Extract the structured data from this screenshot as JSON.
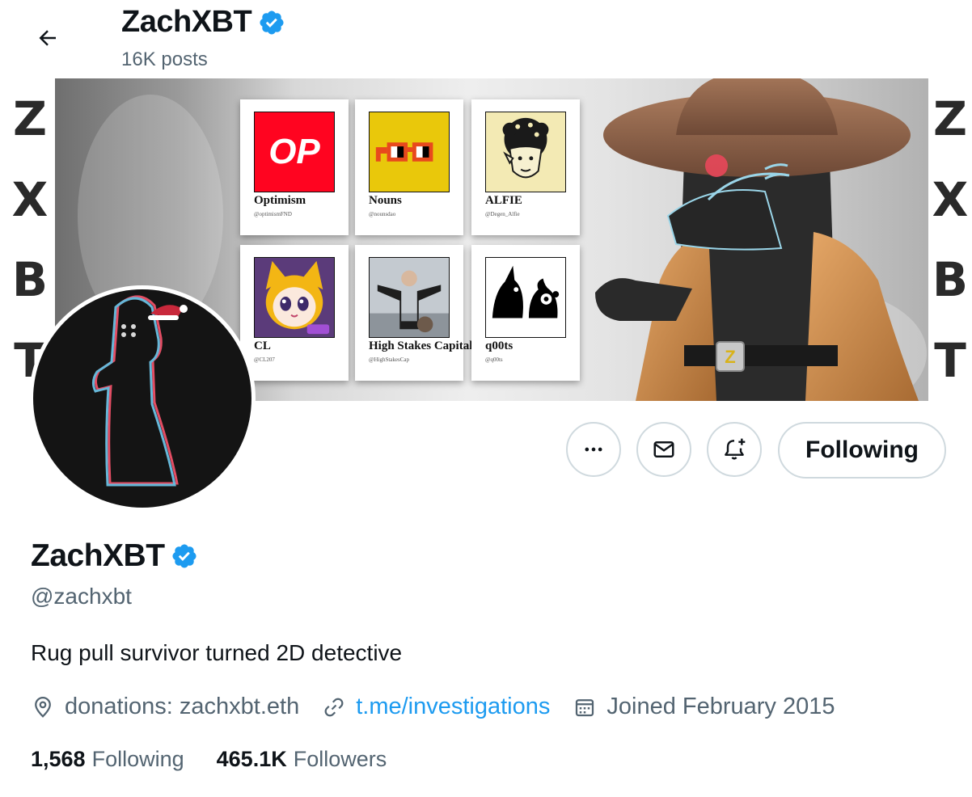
{
  "header": {
    "title": "ZachXBT",
    "posts": "16K posts"
  },
  "banner": {
    "edge_letters": [
      "Z",
      "X",
      "B",
      "T"
    ],
    "cards": [
      {
        "name": "Optimism",
        "handle": "@optimismFND",
        "logo_text": "OP"
      },
      {
        "name": "Nouns",
        "handle": "@nounsdao"
      },
      {
        "name": "ALFIE",
        "handle": "@Degen_Alfie"
      },
      {
        "name": "CL",
        "handle": "@CL207"
      },
      {
        "name": "High Stakes Capital",
        "handle": "@HighStakesCap"
      },
      {
        "name": "q00ts",
        "handle": "@q00ts"
      }
    ]
  },
  "actions": {
    "following_label": "Following"
  },
  "profile": {
    "name": "ZachXBT",
    "handle": "@zachxbt",
    "bio": "Rug pull survivor turned 2D detective",
    "location": "donations: zachxbt.eth",
    "link": "t.me/investigations",
    "joined": "Joined February 2015",
    "following_count": "1,568",
    "following_label": "Following",
    "followers_count": "465.1K",
    "followers_label": "Followers"
  },
  "colors": {
    "verified": "#1d9bf0",
    "link": "#1d9bf0",
    "secondary_text": "#536471",
    "optimism_red": "#ff0420",
    "nouns_yellow": "#e9c80b"
  },
  "icons": [
    "back-arrow-icon",
    "verified-badge-icon",
    "more-icon",
    "mail-icon",
    "bell-plus-icon",
    "location-icon",
    "link-icon",
    "calendar-icon"
  ]
}
